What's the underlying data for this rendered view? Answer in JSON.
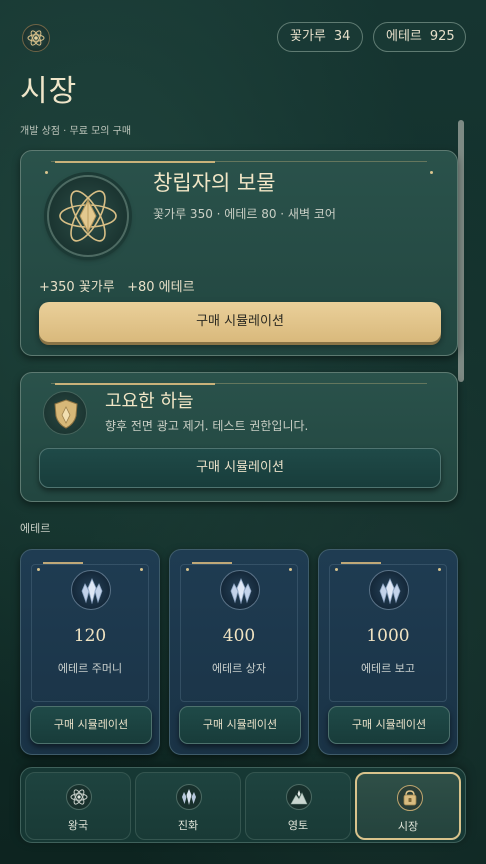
{
  "header": {
    "logo_icon": "atom-emblem-icon",
    "currency": [
      {
        "label": "꽃가루",
        "value": "34"
      },
      {
        "label": "에테르",
        "value": "925"
      }
    ],
    "title": "시장",
    "subtitle": "개발 상점 · 무료 모의 구매"
  },
  "offers": [
    {
      "title": "창립자의 보물",
      "description": "꽃가루 350 · 에테르 80 · 새벽 코어",
      "reward": "+350 꽃가루   +80 에테르",
      "button": "구매 시뮬레이션",
      "icon": "atom-emblem-icon"
    },
    {
      "title": "고요한 하늘",
      "description": "향후 전면 광고 제거. 테스트 권한입니다.",
      "button": "구매 시뮬레이션",
      "icon": "shield-icon"
    }
  ],
  "ether_section": {
    "label": "에테르",
    "packs": [
      {
        "amount": "120",
        "name": "에테르 주머니",
        "button": "구매 시뮬레이션"
      },
      {
        "amount": "400",
        "name": "에테르 상자",
        "button": "구매 시뮬레이션"
      },
      {
        "amount": "1000",
        "name": "에테르 보고",
        "button": "구매 시뮬레이션"
      }
    ]
  },
  "nav": {
    "items": [
      {
        "label": "왕국",
        "icon": "atom-icon"
      },
      {
        "label": "진화",
        "icon": "crystal-icon"
      },
      {
        "label": "영토",
        "icon": "territory-icon"
      },
      {
        "label": "시장",
        "icon": "bag-icon",
        "active": true
      }
    ]
  },
  "colors": {
    "accent_gold": "#e6cb92",
    "panel": "#24483f",
    "ether_panel": "#1d3a4f"
  }
}
